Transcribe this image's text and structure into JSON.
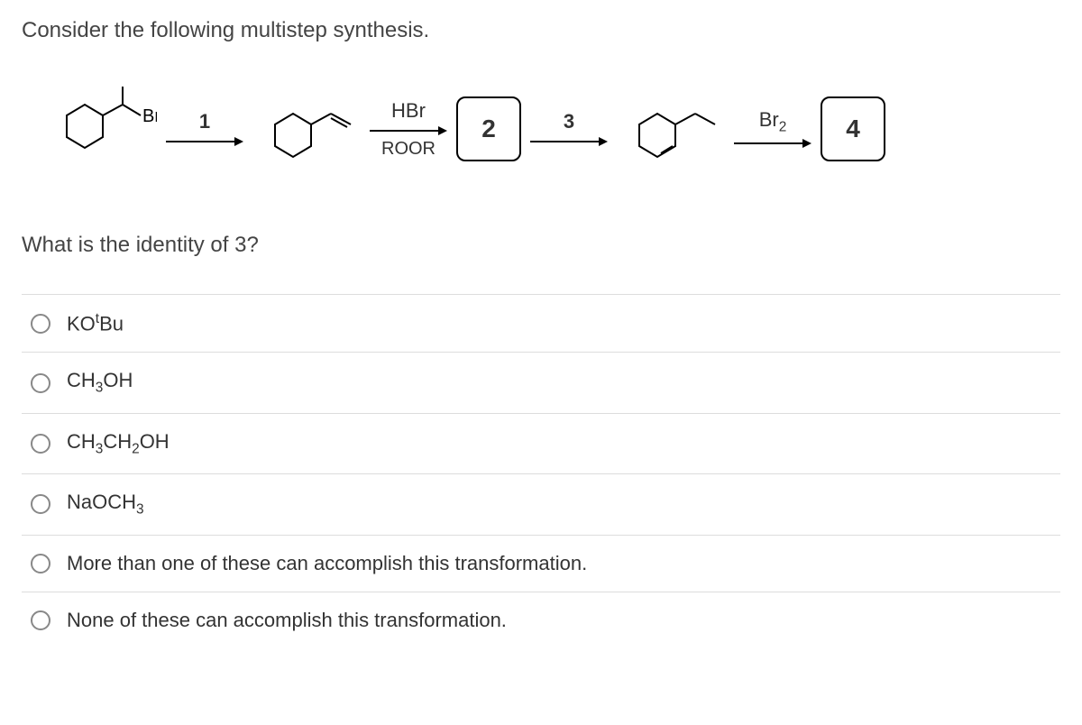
{
  "question_intro": "Consider the following multistep synthesis.",
  "scheme": {
    "start_sub_label": "Br",
    "step1_label": "1",
    "step2_top": "HBr",
    "step2_bottom": "ROOR",
    "box2": "2",
    "step3_label": "3",
    "step4_label": "Br",
    "step4_sub": "2",
    "box4": "4"
  },
  "sub_question": "What is the identity of 3?",
  "options": [
    {
      "html": "KO<sup>t</sup>Bu"
    },
    {
      "html": "CH<sub>3</sub>OH"
    },
    {
      "html": "CH<sub>3</sub>CH<sub>2</sub>OH"
    },
    {
      "html": "NaOCH<sub>3</sub>"
    },
    {
      "html": "More than one of these can accomplish this transformation."
    },
    {
      "html": "None of these can accomplish this transformation."
    }
  ]
}
